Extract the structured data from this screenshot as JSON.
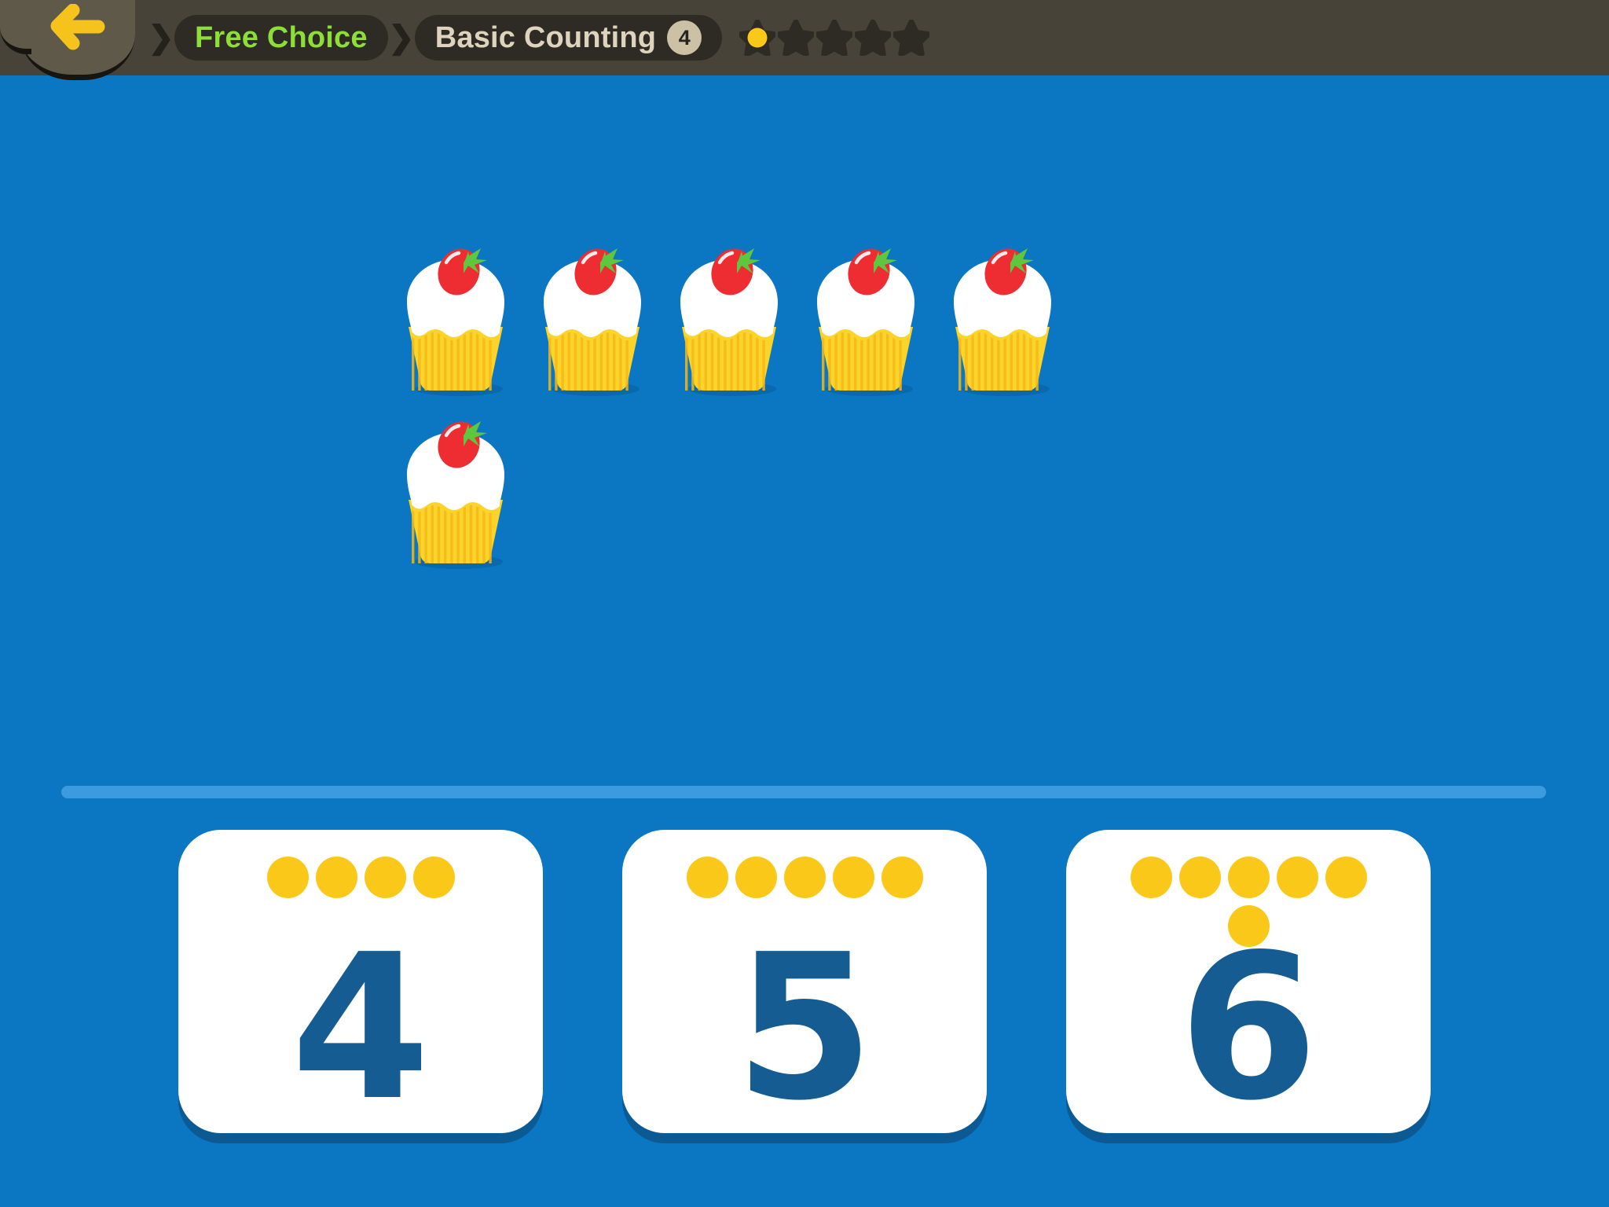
{
  "app": {
    "background_color": "#0b76c2",
    "header_color": "#474339"
  },
  "header": {
    "back_button": {
      "name": "back-button",
      "icon": "arrow-left-icon",
      "color": "#f6c31d"
    },
    "breadcrumb": [
      {
        "label": "Free Choice",
        "color": "#8ede3a",
        "badge": null
      },
      {
        "label": "Basic Counting",
        "color": "#ded3bd",
        "badge": "4"
      }
    ],
    "separator": "❯",
    "progress_stars": {
      "total": 5,
      "filled": 1,
      "filled_color": "#f9c819",
      "empty_color": "#2e2b24"
    }
  },
  "question": {
    "prompt_type": "count-the-objects",
    "object": "cupcake",
    "object_count": 6,
    "row_layout": [
      5,
      1
    ],
    "cupcake_colors": {
      "wrapper": "#fbd429",
      "wrapper_stripe": "#f5b717",
      "frosting": "#ffffff",
      "berry": "#ee2d32",
      "leaf": "#5cc73f"
    }
  },
  "divider": {
    "color": "#3c9ade"
  },
  "answers": {
    "cards": [
      {
        "number": "4",
        "dots": 4,
        "dots_rows": [
          4
        ]
      },
      {
        "number": "5",
        "dots": 5,
        "dots_rows": [
          5
        ]
      },
      {
        "number": "6",
        "dots": 6,
        "dots_rows": [
          5,
          1
        ]
      }
    ],
    "dot_color": "#f9c819",
    "number_color": "#145c92",
    "card_color": "#ffffff",
    "card_shadow_color": "#0b5a94"
  }
}
